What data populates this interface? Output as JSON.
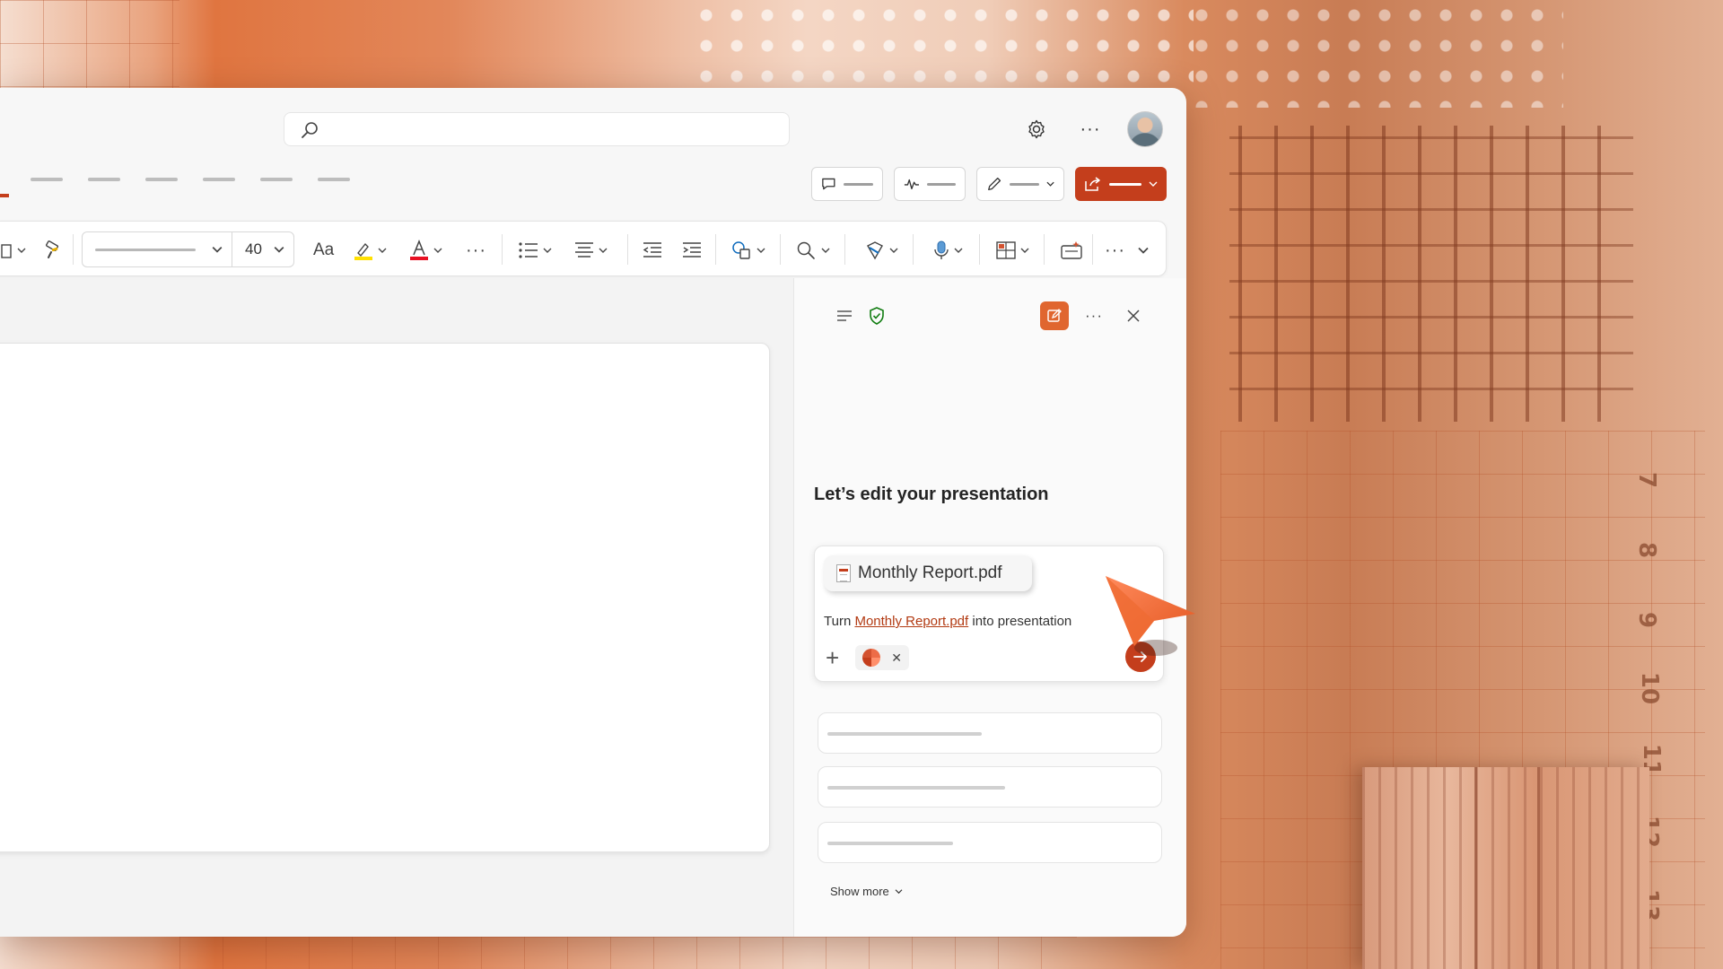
{
  "search": {
    "placeholder": ""
  },
  "toolbar": {
    "font_size": "40",
    "font_size_label": "Aa"
  },
  "pane": {
    "title": "Let’s edit your presentation",
    "attachment_name": "Monthly Report.pdf",
    "prompt_prefix": "Turn ",
    "prompt_link": "Monthly Report.pdf",
    "prompt_suffix": " into presentation",
    "show_more": "Show more"
  },
  "colors": {
    "accent": "#c43e1c",
    "highlight": "#ffe000",
    "font_color": "#e81123",
    "shield": "#107c10"
  },
  "icons": [
    "search-icon",
    "gear-icon",
    "more-icon",
    "avatar",
    "comment-icon",
    "activity-icon",
    "pen-icon",
    "share-icon",
    "format-painter-icon",
    "highlighter-icon",
    "font-color-icon",
    "bullets-icon",
    "align-icon",
    "decrease-indent-icon",
    "increase-indent-icon",
    "shapes-icon",
    "find-icon",
    "designer-icon",
    "dictate-icon",
    "layout-icon",
    "add-in-icon",
    "hamburger-icon",
    "shield-icon",
    "new-chat-icon",
    "close-icon"
  ]
}
